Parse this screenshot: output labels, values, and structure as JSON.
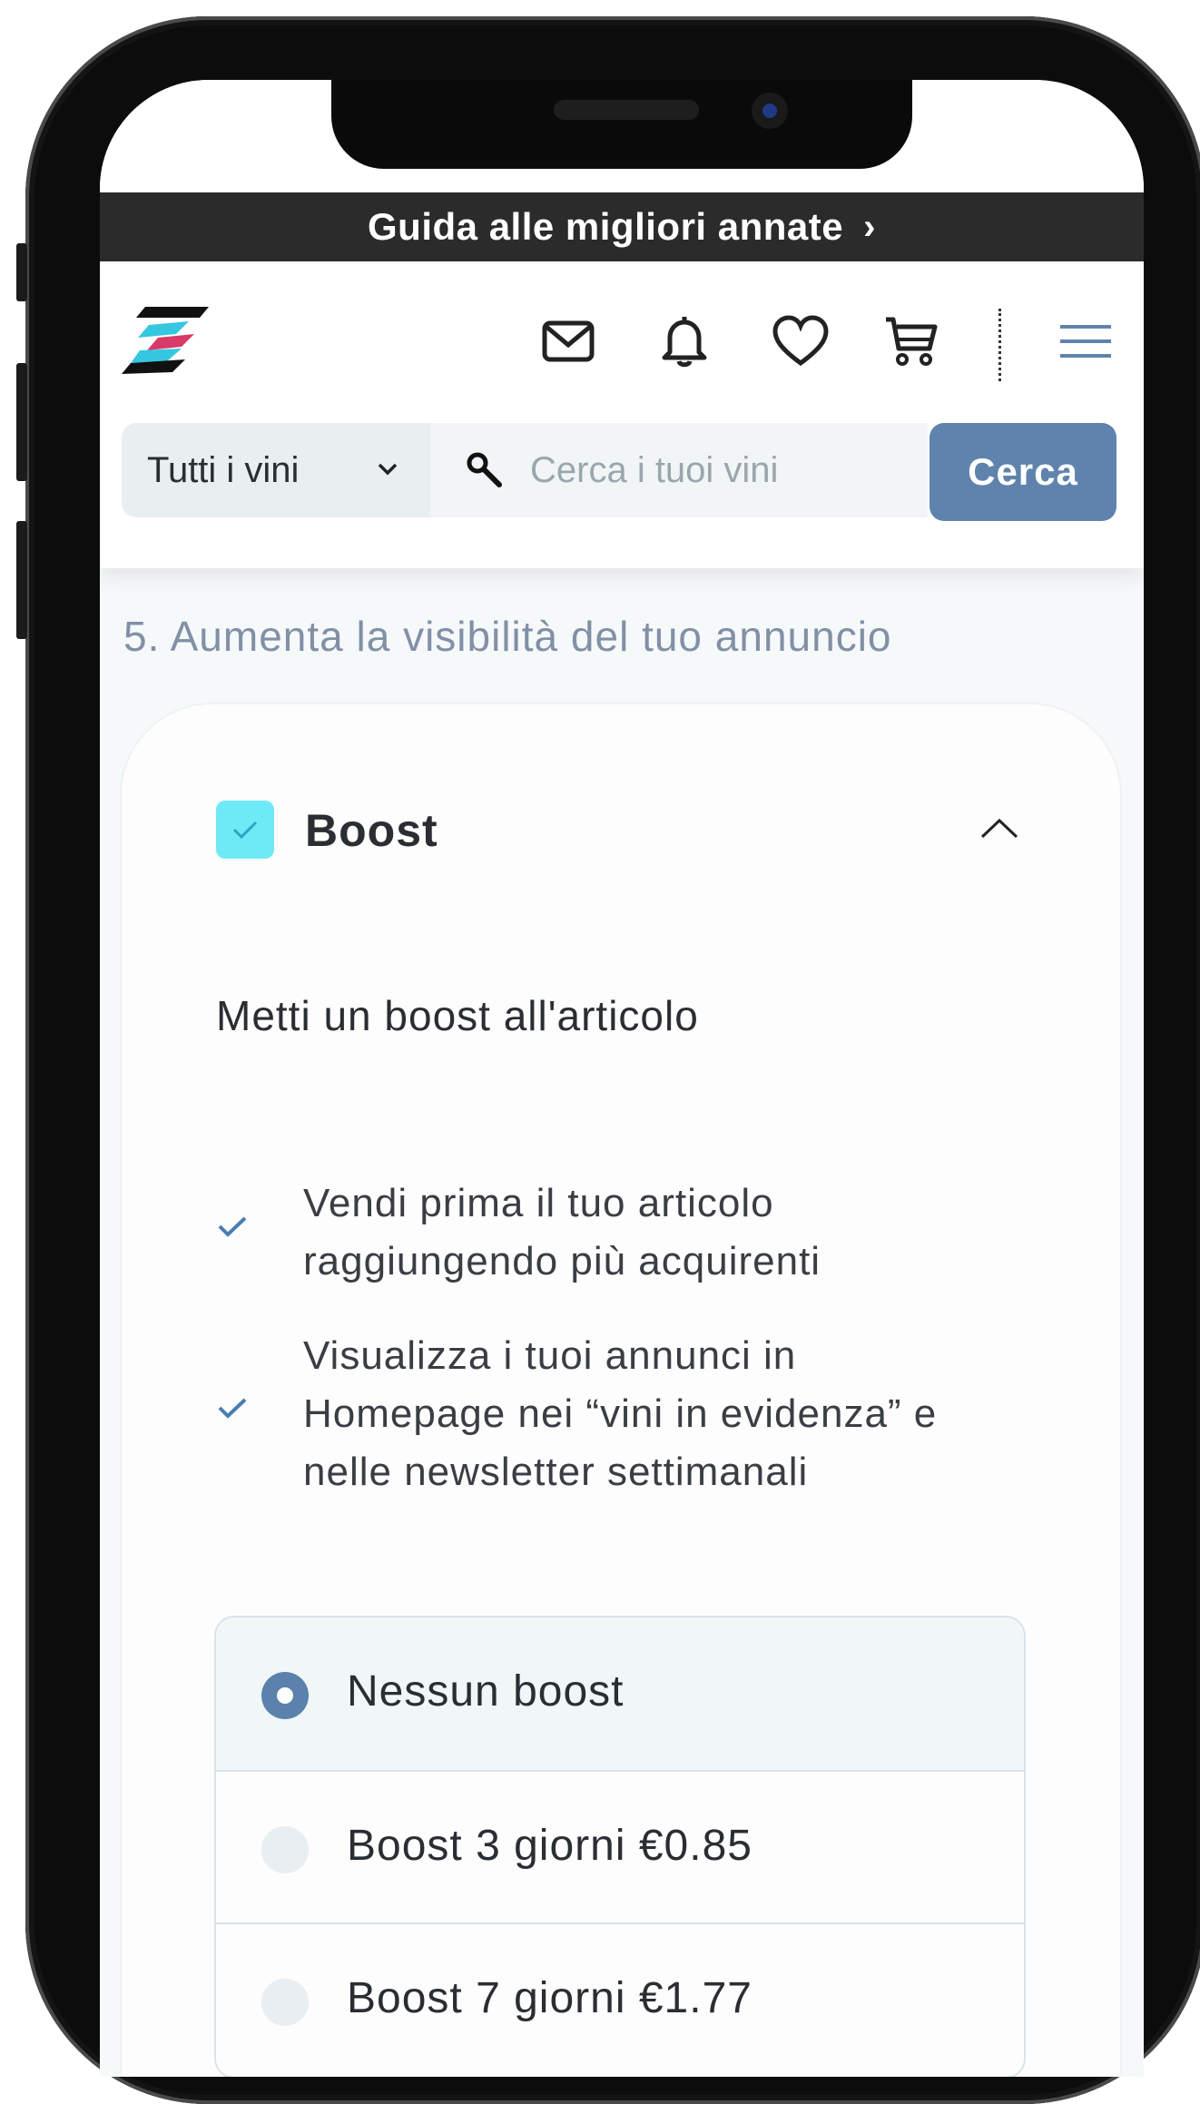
{
  "promo": {
    "label": "Guida alle migliori annate",
    "chevron": "›"
  },
  "header": {
    "icons": [
      "mail-icon",
      "bell-icon",
      "heart-icon",
      "cart-icon",
      "menu-icon"
    ],
    "filter": {
      "selected": "Tutti i vini"
    },
    "search": {
      "placeholder": "Cerca i tuoi vini",
      "button_label": "Cerca"
    }
  },
  "section": {
    "title": "5. Aumenta la visibilità del tuo annuncio"
  },
  "boost": {
    "title": "Boost",
    "checked": true,
    "subhead": "Metti un boost all'articolo",
    "benefits": [
      {
        "line1": "Vendi prima il tuo articolo",
        "line2": "raggiungendo più acquirenti"
      },
      {
        "line1": "Visualizza i tuoi annunci in",
        "line2": "Homepage nei “vini in evidenza” e",
        "line3": "nelle newsletter settimanali"
      }
    ],
    "options": [
      {
        "label": "Nessun boost",
        "selected": true
      },
      {
        "label": "Boost 3 giorni €0.85",
        "selected": false
      },
      {
        "label": "Boost 7 giorni €1.77",
        "selected": false
      }
    ]
  },
  "colors": {
    "accent": "#5f83ac",
    "check": "#6eeaf7",
    "promo_bg": "#2b2b2b"
  }
}
